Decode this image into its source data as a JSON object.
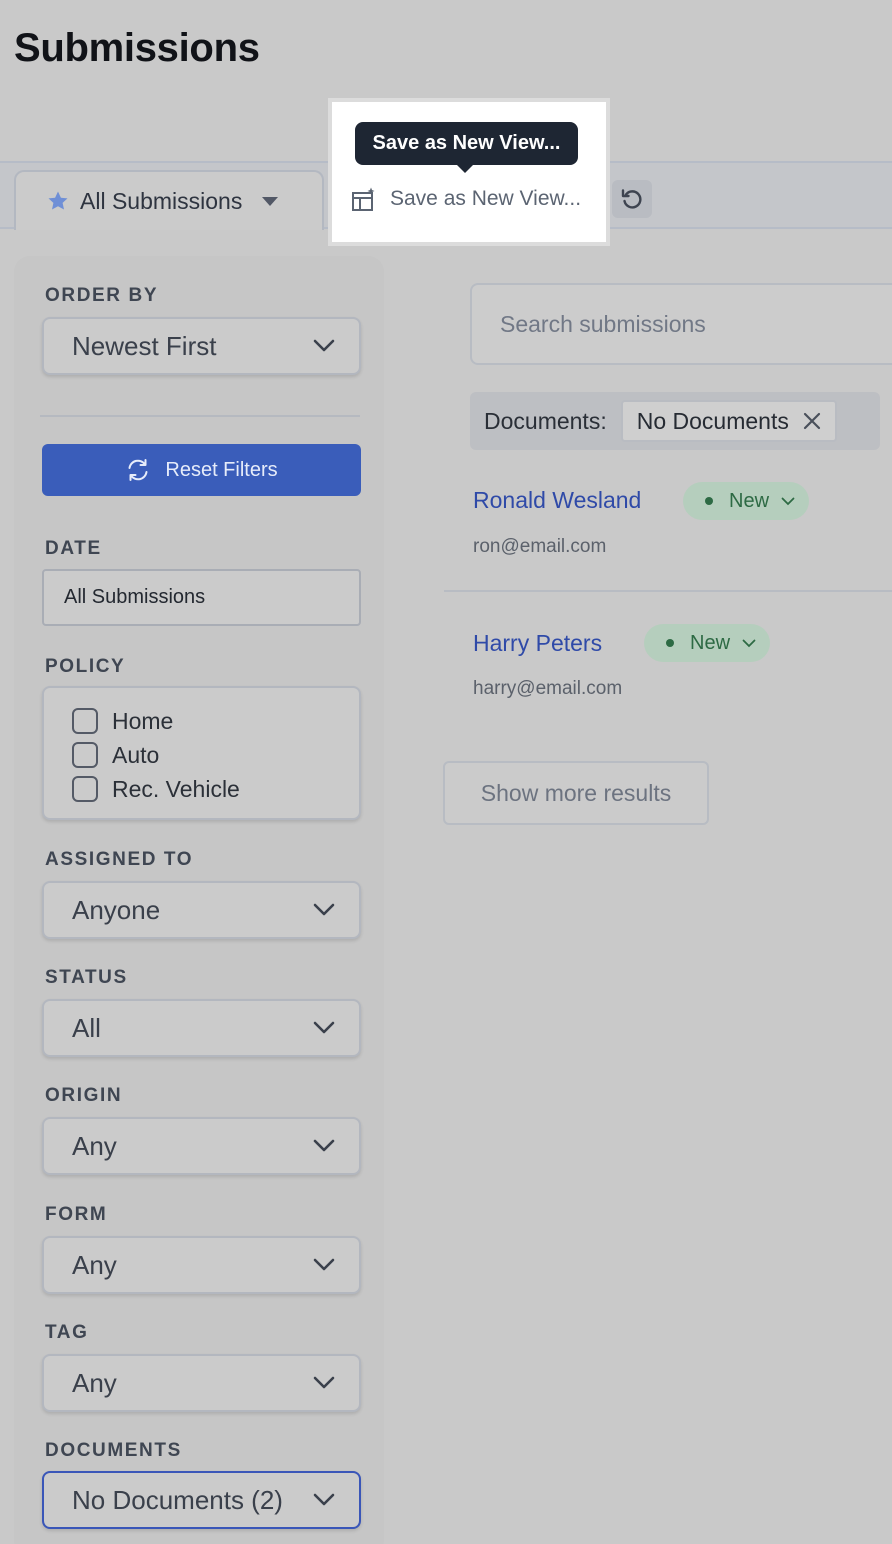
{
  "page": {
    "title": "Submissions"
  },
  "views": {
    "current_view": "All Submissions",
    "save_view_label": "Save as New View...",
    "tooltip": "Save as New View..."
  },
  "sidebar": {
    "order_by": {
      "label": "ORDER BY",
      "value": "Newest First"
    },
    "reset_filters": "Reset Filters",
    "date": {
      "label": "DATE",
      "value": "All Submissions"
    },
    "policy": {
      "label": "POLICY",
      "options": [
        {
          "label": "Home",
          "checked": false
        },
        {
          "label": "Auto",
          "checked": false
        },
        {
          "label": "Rec. Vehicle",
          "checked": false
        }
      ]
    },
    "assigned_to": {
      "label": "ASSIGNED TO",
      "value": "Anyone"
    },
    "status": {
      "label": "STATUS",
      "value": "All"
    },
    "origin": {
      "label": "ORIGIN",
      "value": "Any"
    },
    "form": {
      "label": "FORM",
      "value": "Any"
    },
    "tag": {
      "label": "TAG",
      "value": "Any"
    },
    "documents": {
      "label": "DOCUMENTS",
      "value": "No Documents (2)"
    }
  },
  "main": {
    "search": {
      "placeholder": "Search submissions",
      "value": ""
    },
    "active_filter": {
      "label": "Documents:",
      "chip": "No Documents"
    },
    "results": [
      {
        "name": "Ronald Wesland",
        "email": "ron@email.com",
        "status": "New"
      },
      {
        "name": "Harry Peters",
        "email": "harry@email.com",
        "status": "New"
      }
    ],
    "show_more": "Show more results"
  },
  "colors": {
    "accent": "#3a5dba",
    "link": "#2f4aa8",
    "status_new_bg": "#b5cebd",
    "status_new_text": "#2d6a44",
    "tooltip_bg": "#1e2633"
  }
}
